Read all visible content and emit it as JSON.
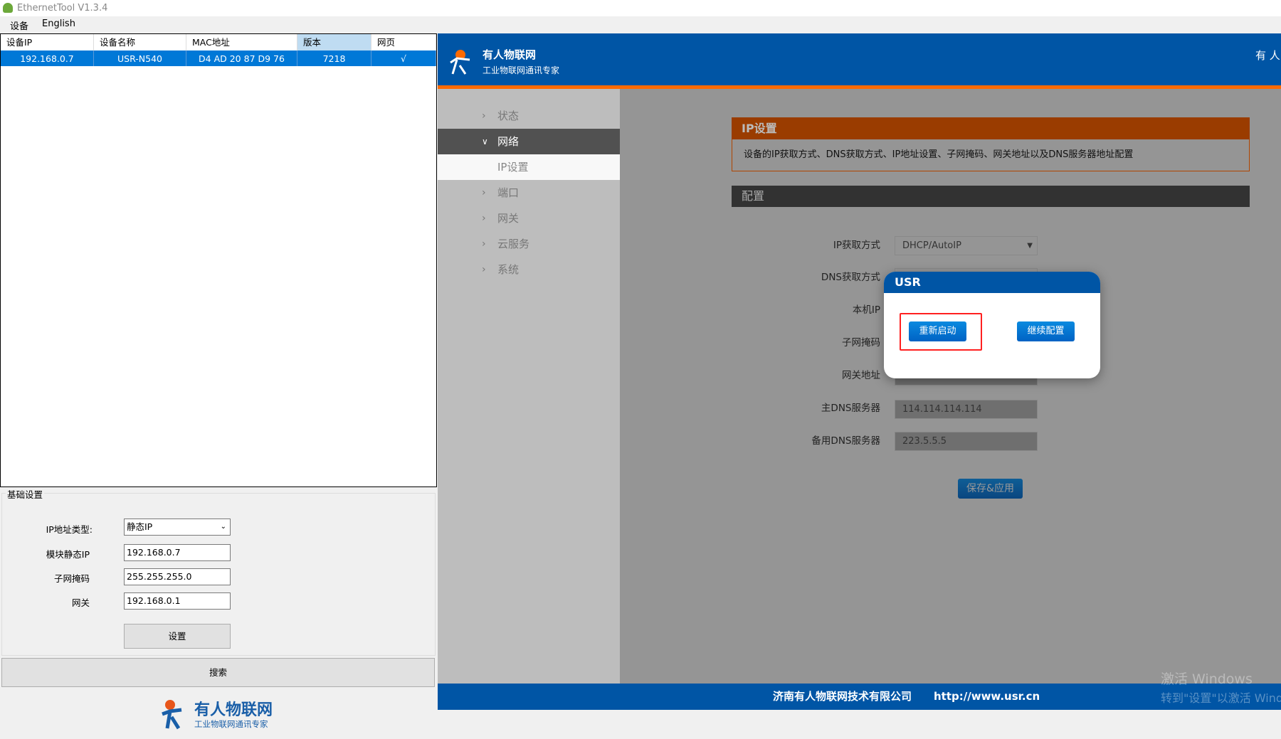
{
  "window": {
    "title": "EthernetTool V1.3.4"
  },
  "menu": [
    "设备",
    "English"
  ],
  "device_table": {
    "columns": [
      "设备IP",
      "设备名称",
      "MAC地址",
      "版本",
      "网页"
    ],
    "rows": [
      [
        "192.168.0.7",
        "USR-N540",
        "D4 AD 20 87 D9 76",
        "7218",
        "√"
      ]
    ]
  },
  "basic_settings": {
    "title": "基础设置",
    "ip_type_label": "IP地址类型:",
    "ip_type_value": "静态IP",
    "static_ip_label": "模块静态IP",
    "static_ip_value": "192.168.0.7",
    "mask_label": "子网掩码",
    "mask_value": "255.255.255.0",
    "gateway_label": "网关",
    "gateway_value": "192.168.0.1",
    "set_button": "设置"
  },
  "search_button": "搜索",
  "brand": {
    "name": "有人物联网",
    "slogan": "工业物联网通讯专家",
    "header_right": "有 人"
  },
  "sidebar": [
    {
      "label": "状态",
      "expanded": false
    },
    {
      "label": "网络",
      "expanded": true,
      "active": true
    },
    {
      "label": "IP设置",
      "sub": true,
      "selected": true
    },
    {
      "label": "端口"
    },
    {
      "label": "网关"
    },
    {
      "label": "云服务"
    },
    {
      "label": "系统"
    }
  ],
  "section": {
    "title": "IP设置",
    "description": "设备的IP获取方式、DNS获取方式、IP地址设置、子网掩码、网关地址以及DNS服务器地址配置",
    "config_title": "配置"
  },
  "form": {
    "ip_mode_label": "IP获取方式",
    "ip_mode_value": "DHCP/AutoIP",
    "dns_mode_label": "DNS获取方式",
    "local_ip_label": "本机IP",
    "mask_label": "子网掩码",
    "gateway_label": "网关地址",
    "dns1_label": "主DNS服务器",
    "dns1_value": "114.114.114.114",
    "dns2_label": "备用DNS服务器",
    "dns2_value": "223.5.5.5",
    "save_button": "保存&应用"
  },
  "dialog": {
    "title": "USR",
    "restart_button": "重新启动",
    "continue_button": "继续配置"
  },
  "footer": {
    "company": "济南有人物联网技术有限公司",
    "url": "http://www.usr.cn"
  },
  "watermark": {
    "line1": "激活 Windows",
    "line2": "转到\"设置\"以激活 Windows"
  },
  "colors": {
    "brand_blue": "#0055a5",
    "accent_orange": "#ff6a00",
    "highlight": "#ff2020"
  }
}
